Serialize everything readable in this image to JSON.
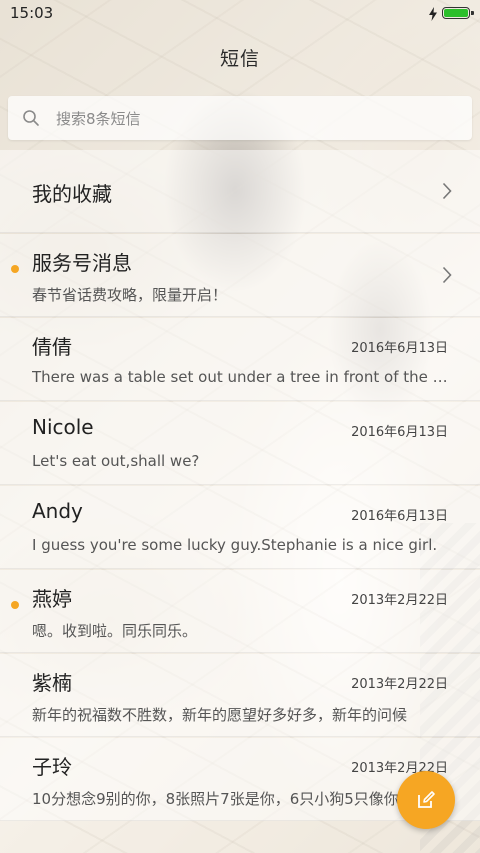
{
  "status_bar": {
    "time": "15:03",
    "battery_color": "#2bbf2b"
  },
  "header": {
    "title": "短信"
  },
  "search": {
    "placeholder": "搜索8条短信",
    "value": ""
  },
  "colors": {
    "accent": "#f6a623",
    "unread_dot": "#f5a623"
  },
  "messages": [
    {
      "name": "我的收藏",
      "preview": "",
      "date": "",
      "unread": false,
      "chevron": true
    },
    {
      "name": "服务号消息",
      "preview": "春节省话费攻略，限量开启！",
      "date": "",
      "unread": true,
      "chevron": true
    },
    {
      "name": "倩倩",
      "preview": "There was a table set out under a tree in front of the house",
      "date": "2016年6月13日",
      "unread": false
    },
    {
      "name": "Nicole",
      "preview": "Let's eat out,shall we?",
      "date": "2016年6月13日",
      "unread": false
    },
    {
      "name": "Andy",
      "preview": "I guess you're some lucky guy.Stephanie is a nice girl.",
      "date": "2016年6月13日",
      "unread": false
    },
    {
      "name": "燕婷",
      "preview": "嗯。收到啦。同乐同乐。",
      "date": "2013年2月22日",
      "unread": true
    },
    {
      "name": "紫楠",
      "preview": "新年的祝福数不胜数，新年的愿望好多好多，新年的问候",
      "date": "2013年2月22日",
      "unread": false
    },
    {
      "name": "子玲",
      "preview": "10分想念9别的你，8张照片7张是你，6只小狗5只像你",
      "date": "2013年2月22日",
      "unread": false
    }
  ],
  "icons": {
    "search": "search-icon",
    "chevron": "chevron-right-icon",
    "compose": "compose-icon",
    "charge": "charging-icon",
    "battery": "battery-icon"
  }
}
